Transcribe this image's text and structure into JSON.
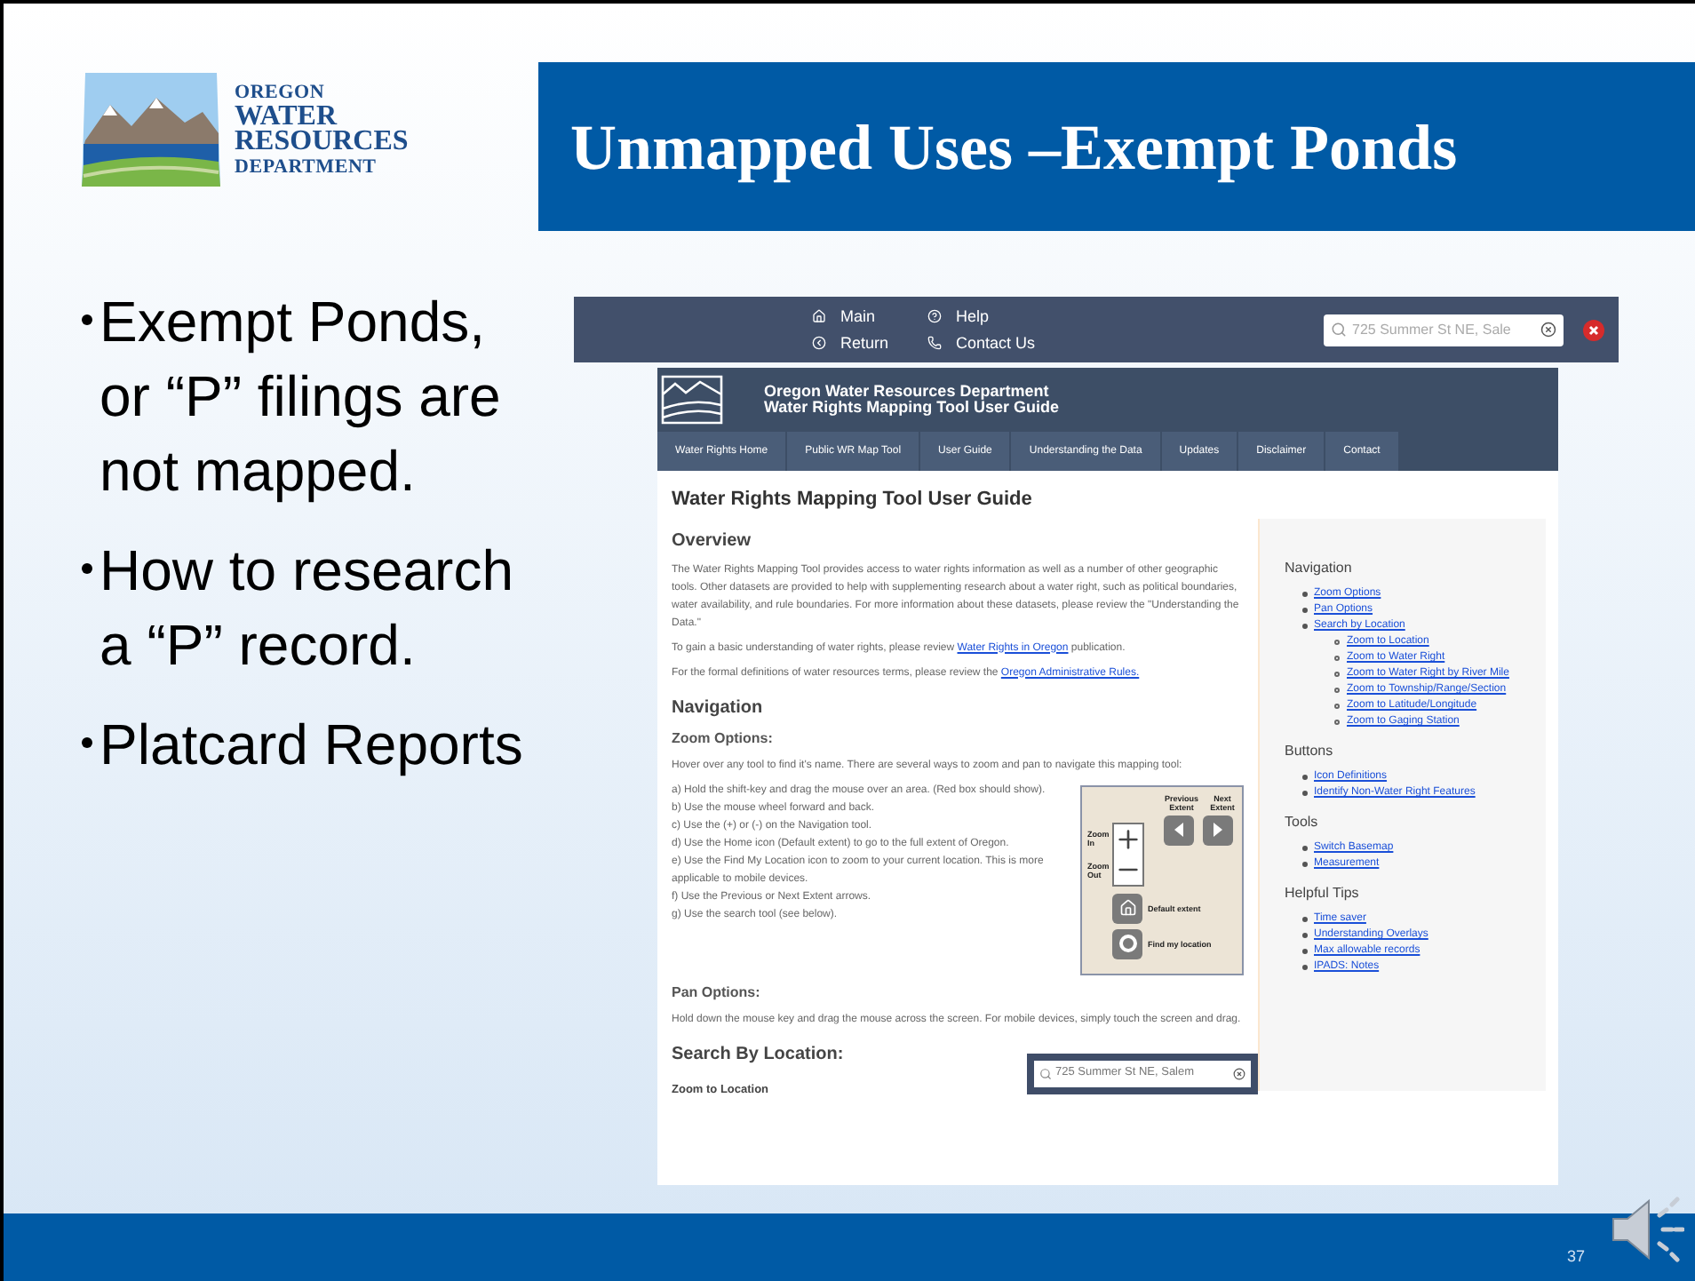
{
  "slide": {
    "logo_text": [
      "OREGON",
      "WATER",
      "RESOURCES",
      "DEPARTMENT"
    ],
    "title": "Unmapped Uses –Exempt Ponds",
    "bullets": [
      "Exempt Ponds, or “P” filings are not mapped.",
      "How to research a “P” record.",
      "Platcard Reports"
    ],
    "page_number": "37"
  },
  "screenshot": {
    "toolbar": {
      "links": [
        [
          "Main",
          "Return"
        ],
        [
          "Help",
          "Contact Us"
        ]
      ],
      "search": {
        "placeholder": "725 Summer St NE, Sale"
      }
    },
    "site_header": {
      "title": "Oregon Water Resources Department",
      "subtitle": "Water Rights Mapping Tool User Guide"
    },
    "nav": [
      {
        "label": "Water Rights Home"
      },
      {
        "label": "Public WR Map Tool"
      },
      {
        "label": "User Guide"
      },
      {
        "label": "Understanding the Data"
      },
      {
        "label": "Updates"
      },
      {
        "label": "Disclaimer"
      },
      {
        "label": "Contact"
      }
    ],
    "content": [
      {
        "kind": "title",
        "text": "Water Rights Mapping Tool User Guide"
      },
      {
        "kind": "heading",
        "text": "Overview"
      },
      {
        "kind": "paragraph",
        "text": "The Water Rights Mapping Tool provides access to water rights information as well as a number of other geographic tools. Other datasets are provided to help with supplementing research about a water right, such as political boundaries, water availability, and rule boundaries. For more information about these datasets, please review the \"Understanding the Data.\""
      },
      {
        "kind": "paragraph",
        "text": "To gain a basic understanding of water rights, please review ",
        "link": "Water Rights in Oregon",
        "after": " publication."
      },
      {
        "kind": "paragraph",
        "text": "For the formal definitions of water resources terms, please review the ",
        "link": "Oregon Administrative Rules."
      },
      {
        "kind": "heading",
        "text": "Navigation"
      },
      {
        "kind": "subheading",
        "text": "Zoom Options:"
      },
      {
        "kind": "paragraph",
        "text": "Hover over any tool to find it's name. There are several ways to zoom and pan to navigate this mapping tool:"
      },
      {
        "kind": "steps",
        "items": [
          "a) Hold the shift-key and drag the mouse over an area. (Red box should show).",
          "b) Use the mouse wheel forward and back.",
          "c) Use the (+) or (-) on the Navigation tool.",
          "d) Use the Home icon (Default extent) to go to the full extent of Oregon.",
          "e) Use the Find My Location icon to zoom to your current location. This is more applicable to mobile devices.",
          "f) Use the Previous or Next Extent arrows.",
          "g) Use the search tool (see below)."
        ],
        "figure": {
          "previous": "Previous Extent",
          "next": "Next Extent",
          "zoom_in": "Zoom In",
          "zoom_out": "Zoom Out",
          "default": "Default extent",
          "locate": "Find my location"
        }
      },
      {
        "kind": "subheading",
        "text": "Pan Options:"
      },
      {
        "kind": "paragraph",
        "text": "Hold down the mouse key and drag the mouse across the screen. For mobile devices, simply touch the screen and drag."
      },
      {
        "kind": "heading",
        "text": "Search By Location:"
      },
      {
        "kind": "minor",
        "text": "Zoom to Location",
        "search_placeholder": "725 Summer St NE, Salem"
      }
    ],
    "sidebar": [
      {
        "title": "Navigation",
        "items": [
          {
            "label": "Zoom Options"
          },
          {
            "label": "Pan Options"
          },
          {
            "label": "Search by Location",
            "children": [
              {
                "label": "Zoom to Location"
              },
              {
                "label": "Zoom to Water Right"
              },
              {
                "label": "Zoom to Water Right by River Mile"
              },
              {
                "label": "Zoom to Township/Range/Section"
              },
              {
                "label": "Zoom to Latitude/Longitude"
              },
              {
                "label": "Zoom to Gaging Station"
              }
            ]
          }
        ]
      },
      {
        "title": "Buttons",
        "items": [
          {
            "label": "Icon Definitions"
          },
          {
            "label": "Identify Non-Water Right Features"
          }
        ]
      },
      {
        "title": "Tools",
        "items": [
          {
            "label": "Switch Basemap"
          },
          {
            "label": "Measurement"
          }
        ]
      },
      {
        "title": "Helpful Tips",
        "items": [
          {
            "label": "Time saver"
          },
          {
            "label": "Understanding Overlays"
          },
          {
            "label": "Max allowable records"
          },
          {
            "label": "IPADS: Notes"
          }
        ]
      }
    ]
  }
}
